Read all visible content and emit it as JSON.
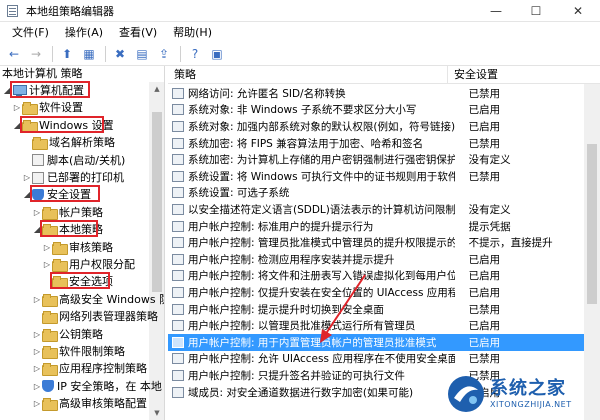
{
  "window": {
    "title": "本地组策略编辑器",
    "buttons": {
      "minimize": "—",
      "maximize": "☐",
      "close": "✕"
    }
  },
  "menu": [
    "文件(F)",
    "操作(A)",
    "查看(V)",
    "帮助(H)"
  ],
  "toolbar": [
    {
      "icon": "back-arrow-icon",
      "glyph": "←",
      "enabled": true
    },
    {
      "icon": "forward-arrow-icon",
      "glyph": "→",
      "enabled": false
    },
    {
      "icon": "up-folder-icon",
      "glyph": "⬆",
      "enabled": true
    },
    {
      "icon": "show-hide-tree-icon",
      "glyph": "▦",
      "enabled": true
    },
    {
      "icon": "delete-icon",
      "glyph": "✖",
      "enabled": true
    },
    {
      "icon": "properties-icon",
      "glyph": "▤",
      "enabled": true
    },
    {
      "icon": "export-list-icon",
      "glyph": "⇪",
      "enabled": true
    },
    {
      "icon": "help-icon",
      "glyph": "?",
      "enabled": true
    },
    {
      "icon": "action-pane-icon",
      "glyph": "▣",
      "enabled": true
    }
  ],
  "tree": {
    "header": "本地计算机 策略",
    "items": [
      {
        "label": "计算机配置",
        "indent": 0,
        "arrow": "◢",
        "icon": "computer-icon",
        "boxed": true
      },
      {
        "label": "软件设置",
        "indent": 1,
        "arrow": "▷",
        "icon": "folder-icon"
      },
      {
        "label": "Windows 设置",
        "indent": 1,
        "arrow": "◢",
        "icon": "folder-icon",
        "boxed": true
      },
      {
        "label": "域名解析策略",
        "indent": 2,
        "arrow": "",
        "icon": "folder-icon"
      },
      {
        "label": "脚本(启动/关机)",
        "indent": 2,
        "arrow": "",
        "icon": "doc-icon"
      },
      {
        "label": "已部署的打印机",
        "indent": 2,
        "arrow": "▷",
        "icon": "doc-icon"
      },
      {
        "label": "安全设置",
        "indent": 2,
        "arrow": "◢",
        "icon": "shield-icon",
        "boxed": true
      },
      {
        "label": "帐户策略",
        "indent": 3,
        "arrow": "▷",
        "icon": "folder-icon"
      },
      {
        "label": "本地策略",
        "indent": 3,
        "arrow": "◢",
        "icon": "folder-icon",
        "boxed": true
      },
      {
        "label": "审核策略",
        "indent": 4,
        "arrow": "▷",
        "icon": "folder-icon"
      },
      {
        "label": "用户权限分配",
        "indent": 4,
        "arrow": "▷",
        "icon": "folder-icon"
      },
      {
        "label": "安全选项",
        "indent": 4,
        "arrow": "",
        "icon": "folder-icon",
        "boxed": true
      },
      {
        "label": "高级安全 Windows 防",
        "indent": 3,
        "arrow": "▷",
        "icon": "folder-icon"
      },
      {
        "label": "网络列表管理器策略",
        "indent": 3,
        "arrow": "",
        "icon": "folder-icon"
      },
      {
        "label": "公钥策略",
        "indent": 3,
        "arrow": "▷",
        "icon": "folder-icon"
      },
      {
        "label": "软件限制策略",
        "indent": 3,
        "arrow": "▷",
        "icon": "folder-icon"
      },
      {
        "label": "应用程序控制策略",
        "indent": 3,
        "arrow": "▷",
        "icon": "folder-icon"
      },
      {
        "label": "IP 安全策略，在 本地",
        "indent": 3,
        "arrow": "▷",
        "icon": "shield-icon"
      },
      {
        "label": "高级审核策略配置",
        "indent": 3,
        "arrow": "▷",
        "icon": "folder-icon"
      }
    ]
  },
  "list": {
    "columns": {
      "policy": "策略",
      "setting": "安全设置"
    },
    "rows": [
      {
        "policy": "网络访问: 允许匿名 SID/名称转换",
        "setting": "已禁用"
      },
      {
        "policy": "系统对象: 非 Windows 子系统不要求区分大小写",
        "setting": "已启用"
      },
      {
        "policy": "系统对象: 加强内部系统对象的默认权限(例如，符号链接)",
        "setting": "已启用"
      },
      {
        "policy": "系统加密: 将 FIPS 兼容算法用于加密、哈希和签名",
        "setting": "已禁用"
      },
      {
        "policy": "系统加密: 为计算机上存储的用户密钥强制进行强密钥保护",
        "setting": "没有定义"
      },
      {
        "policy": "系统设置: 将 Windows 可执行文件中的证书规则用于软件...",
        "setting": "已禁用"
      },
      {
        "policy": "系统设置: 可选子系统",
        "setting": ""
      },
      {
        "policy": "以安全描述符定义语言(SDDL)语法表示的计算机访问限制",
        "setting": "没有定义"
      },
      {
        "policy": "用户帐户控制: 标准用户的提升提示行为",
        "setting": "提示凭据"
      },
      {
        "policy": "用户帐户控制: 管理员批准模式中管理员的提升权限提示的...",
        "setting": "不提示，直接提升"
      },
      {
        "policy": "用户帐户控制: 检测应用程序安装并提示提升",
        "setting": "已启用"
      },
      {
        "policy": "用户帐户控制: 将文件和注册表写入错误虚拟化到每用户位置",
        "setting": "已启用"
      },
      {
        "policy": "用户帐户控制: 仅提升安装在安全位置的 UIAccess 应用程序",
        "setting": "已启用"
      },
      {
        "policy": "用户帐户控制: 提示提升时切换到安全桌面",
        "setting": "已禁用"
      },
      {
        "policy": "用户帐户控制: 以管理员批准模式运行所有管理员",
        "setting": "已启用"
      },
      {
        "policy": "用户帐户控制: 用于内置管理员帐户的管理员批准模式",
        "setting": "已启用",
        "selected": true
      },
      {
        "policy": "用户帐户控制: 允许 UIAccess 应用程序在不使用安全桌面...",
        "setting": "已禁用"
      },
      {
        "policy": "用户帐户控制: 只提升签名并验证的可执行文件",
        "setting": "已禁用"
      },
      {
        "policy": "域成员: 对安全通道数据进行数字加密(如果可能)",
        "setting": "已启用"
      }
    ]
  },
  "watermark": {
    "name": "系统之家",
    "url": "XITONGZHIJIA.NET"
  },
  "colors": {
    "selection": "#3399ff",
    "annotation": "#e0242a"
  }
}
